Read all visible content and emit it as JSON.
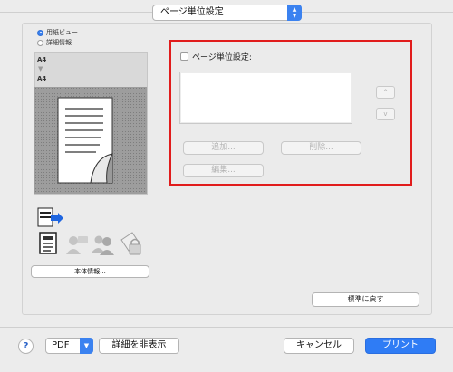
{
  "section_selector": {
    "value": "ページ単位設定"
  },
  "left_panel": {
    "view_options": [
      {
        "label": "用紙ビュー",
        "selected": true
      },
      {
        "label": "詳細情報",
        "selected": false
      }
    ],
    "paper_from": "A4",
    "paper_to": "A4",
    "machine_info_button": "本体情報..."
  },
  "page_setting": {
    "checkbox_label": "ページ単位設定:",
    "checked": false,
    "up_label": "^",
    "down_label": "v",
    "add_button": "追加...",
    "delete_button": "削除...",
    "edit_button": "編集..."
  },
  "reset_button": "標準に戻す",
  "footer": {
    "help_label": "?",
    "pdf_label": "PDF",
    "hide_details_button": "詳細を非表示",
    "cancel_button": "キャンセル",
    "print_button": "プリント"
  },
  "colors": {
    "accent": "#2f7cf5",
    "highlight_border": "#e11c1c"
  },
  "icons": [
    "chevron-updown-icon",
    "paper-curl-preview-icon",
    "page-flow-icon",
    "document-icon",
    "user-settings-icon",
    "users-icon",
    "security-icon"
  ]
}
